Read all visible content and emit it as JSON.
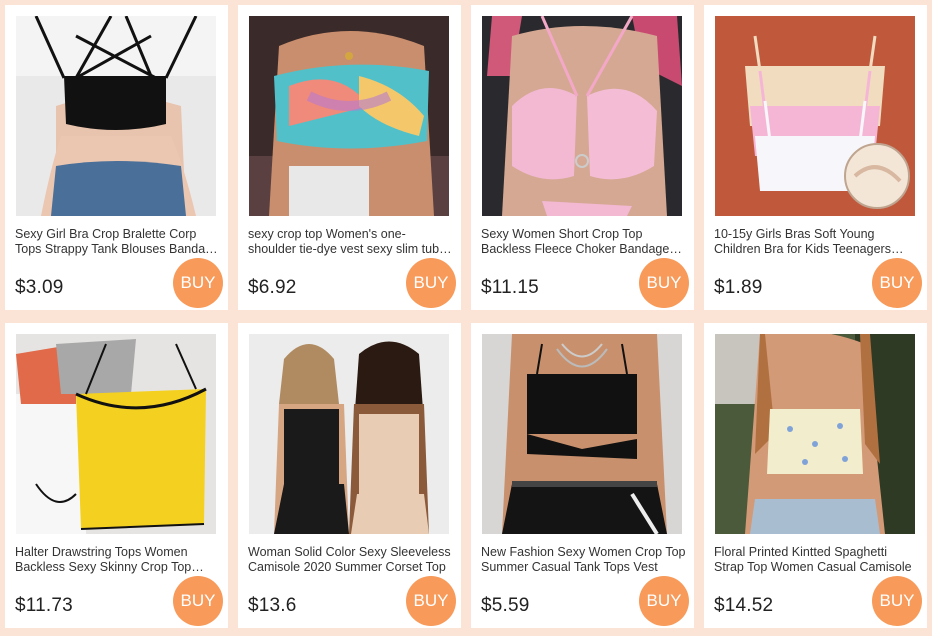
{
  "colors": {
    "page_background": "#fbe4d6",
    "card_background": "#ffffff",
    "buy_button": "#f79a5a",
    "buy_text": "#ffffff",
    "price_text": "#222222",
    "title_text": "#333333"
  },
  "products": [
    {
      "title": "Sexy Girl Bra Crop Bralette Corp Tops Strappy Tank Blouses Bandage Bustier Camisole",
      "price": "$3.09",
      "buy_label": "BUY",
      "image": "black-strappy-bralette-photo"
    },
    {
      "title": "sexy crop top Women's one-shoulder tie-dye vest sexy slim tube top",
      "price": "$6.92",
      "buy_label": "BUY",
      "image": "tie-dye-one-shoulder-top-photo"
    },
    {
      "title": "Sexy Women Short Crop Top Backless Fleece Choker Bandage Bra Top",
      "price": "$11.15",
      "buy_label": "BUY",
      "image": "pink-fluffy-halter-bra-photo"
    },
    {
      "title": "10-15y Girls Bras Soft Young Children Bra for Kids Teenagers Underwear",
      "price": "$1.89",
      "buy_label": "BUY",
      "image": "pastel-training-bras-photo"
    },
    {
      "title": "Halter Drawstring Tops Women Backless Sexy Skinny Crop Top Summer",
      "price": "$11.73",
      "buy_label": "BUY",
      "image": "yellow-halter-tops-photo"
    },
    {
      "title": "Woman Solid Color Sexy Sleeveless Camisole 2020 Summer Corset Top",
      "price": "$13.6",
      "buy_label": "BUY",
      "image": "corset-camisole-models-photo"
    },
    {
      "title": "New Fashion Sexy Women Crop Top Summer Casual Tank Tops Vest",
      "price": "$5.59",
      "buy_label": "BUY",
      "image": "black-cutout-crop-top-photo"
    },
    {
      "title": "Floral Printed Kintted Spaghetti Strap Top Women Casual Camisole",
      "price": "$14.52",
      "buy_label": "BUY",
      "image": "floral-knit-cami-photo"
    }
  ]
}
